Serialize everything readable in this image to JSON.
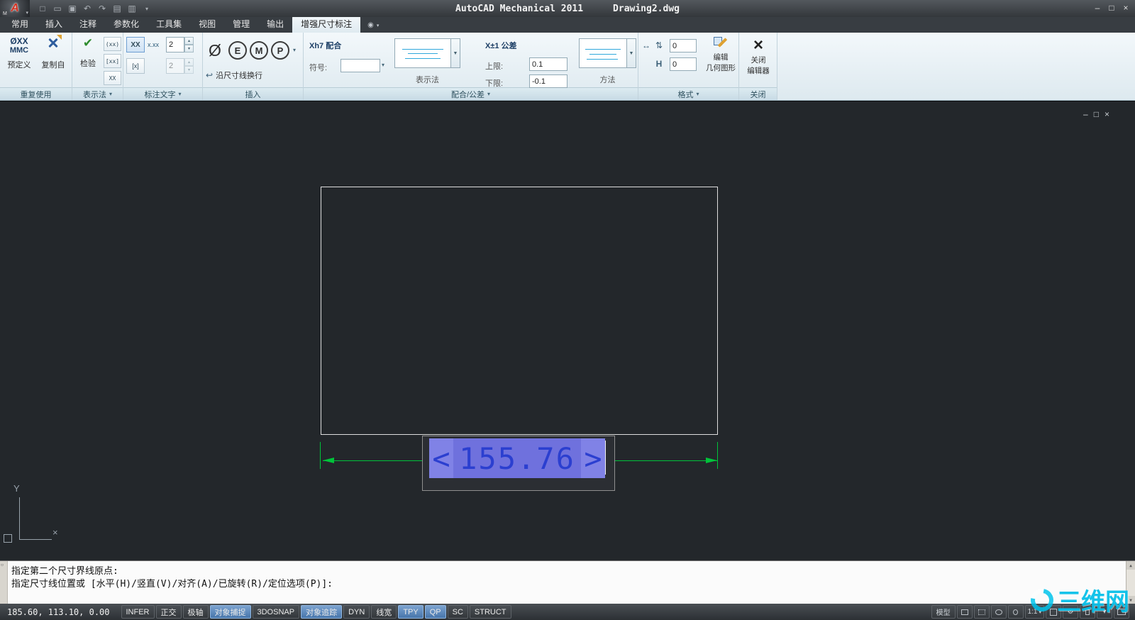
{
  "titlebar": {
    "app_glyph": "A",
    "menu_letter": "M",
    "title": "AutoCAD Mechanical 2011",
    "filename": "Drawing2.dwg"
  },
  "glyphs": {
    "dropdown": "▾",
    "down_big": "▼",
    "spin_up": "▴",
    "spin_down": "▾",
    "check": "✔",
    "scroll_up": "▲",
    "scroll_down": "▼",
    "min": "–",
    "restore": "□",
    "close": "×",
    "gear": "⚙",
    "record": "◉",
    "wrap": "↩",
    "fmt1": "↔",
    "fmt2": "⇅",
    "fmt3": "H",
    "strip_icon": "▫"
  },
  "qat": {
    "icons": [
      {
        "name": "qnew",
        "glyph": "□"
      },
      {
        "name": "open",
        "glyph": "▭"
      },
      {
        "name": "save",
        "glyph": "▣"
      },
      {
        "name": "undo",
        "glyph": "↶"
      },
      {
        "name": "redo",
        "glyph": "↷"
      },
      {
        "name": "plot",
        "glyph": "▤"
      },
      {
        "name": "properties",
        "glyph": "▥"
      }
    ]
  },
  "tabs": [
    {
      "label": "常用"
    },
    {
      "label": "插入"
    },
    {
      "label": "注释"
    },
    {
      "label": "参数化"
    },
    {
      "label": "工具集"
    },
    {
      "label": "视图"
    },
    {
      "label": "管理"
    },
    {
      "label": "输出"
    },
    {
      "label": "增强尺寸标注",
      "active": true
    }
  ],
  "ribbon": {
    "reuse": {
      "label": "重复使用",
      "predef_line1": "ØXX",
      "predef_line2": "MMC",
      "predef_label": "预定义",
      "copy_label": "复制自"
    },
    "rep": {
      "label": "表示法",
      "inspect_label": "检验",
      "b1": "(xx)",
      "b2": "[xx]",
      "b3": "XX"
    },
    "dimtext": {
      "label": "标注文字",
      "xx": "XX",
      "xdot": "x.xx",
      "spin1": "2",
      "b2": "[x]",
      "spin2": "2"
    },
    "insert": {
      "label": "插入",
      "s1": "Ø",
      "s2": "E",
      "s3": "M",
      "s4": "P",
      "wrap_label": "沿尺寸线换行"
    },
    "fits": {
      "label": "配合/公差",
      "fit_title": "Xh7 配合",
      "symbol_label": "符号:",
      "rep_label": "表示法",
      "tol_title": "X±1 公差",
      "upper_label": "上限:",
      "upper_value": "0.1",
      "lower_label": "下限:",
      "lower_value": "-0.1",
      "method_label": "方法"
    },
    "format": {
      "label": "格式",
      "f1": "0",
      "f2": "0",
      "edit1": "编辑",
      "edit2": "几何图形"
    },
    "close": {
      "label": "关闭",
      "c1": "关闭",
      "c2": "编辑器"
    }
  },
  "viewport": {
    "dim_left": "<",
    "dim_value": "155.76",
    "dim_right": ">",
    "ucs_y": "Y",
    "ucs_x": "×"
  },
  "command": {
    "line1": "指定第二个尺寸界线原点:",
    "line2": "指定尺寸线位置或 [水平(H)/竖直(V)/对齐(A)/已旋转(R)/定位选项(P)]:"
  },
  "statusbar": {
    "coords": "185.60, 113.10, 0.00",
    "toggles": [
      {
        "label": "INFER",
        "active": false
      },
      {
        "label": "正交",
        "active": false
      },
      {
        "label": "极轴",
        "active": false
      },
      {
        "label": "对象捕捉",
        "active": true
      },
      {
        "label": "3DOSNAP",
        "active": false
      },
      {
        "label": "对象追踪",
        "active": true
      },
      {
        "label": "DYN",
        "active": false
      },
      {
        "label": "线宽",
        "active": false
      },
      {
        "label": "TPY",
        "active": true
      },
      {
        "label": "QP",
        "active": true
      },
      {
        "label": "SC",
        "active": false
      },
      {
        "label": "STRUCT",
        "active": false
      }
    ],
    "model_label": "模型",
    "scale_label": "1:1"
  },
  "watermark": {
    "text": "三维网"
  }
}
